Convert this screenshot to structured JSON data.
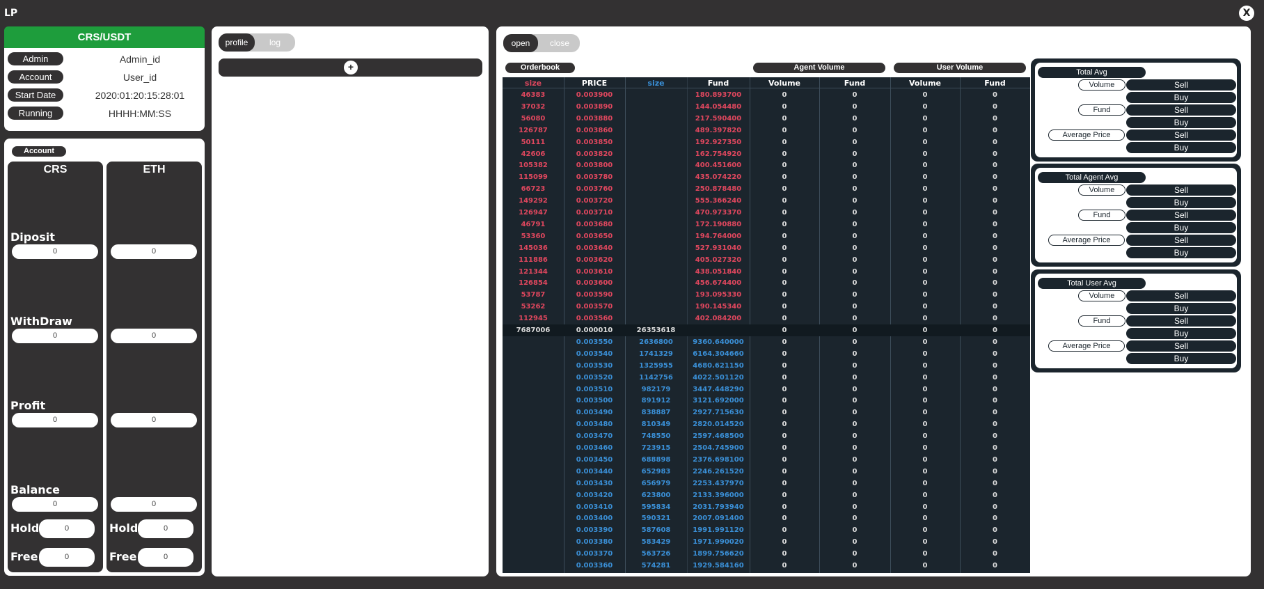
{
  "app": {
    "title": "LP",
    "close_label": "X"
  },
  "info": {
    "pair": "CRS/USDT",
    "rows": [
      {
        "label": "Admin",
        "value": "Admin_id"
      },
      {
        "label": "Account",
        "value": "User_id"
      },
      {
        "label": "Start Date",
        "value": "2020:01:20:15:28:01"
      },
      {
        "label": "Running",
        "value": "HHHH:MM:SS"
      }
    ]
  },
  "account": {
    "title": "Account",
    "columns": [
      "CRS",
      "ETH"
    ],
    "rows": [
      "Diposit",
      "WithDraw",
      "Profit",
      "Balance"
    ],
    "values": {
      "CRS": [
        "0",
        "0",
        "0",
        "0"
      ],
      "ETH": [
        "0",
        "0",
        "0",
        "0"
      ]
    },
    "hold_label": "Hold",
    "free_label": "Free",
    "hold": {
      "CRS": "0",
      "ETH": "0"
    },
    "free": {
      "CRS": "0",
      "ETH": "0"
    }
  },
  "middle": {
    "tab_profile": "profile",
    "tab_log": "log",
    "add_label": "+"
  },
  "right": {
    "tab_open": "open",
    "tab_close": "close"
  },
  "orderbook": {
    "title": "Orderbook",
    "agent_title": "Agent Volume",
    "user_title": "User Volume",
    "headers": [
      "size",
      "PRICE",
      "size",
      "Fund",
      "Volume",
      "Fund",
      "Volume",
      "Fund"
    ],
    "asks": [
      [
        "46383",
        "0.003900",
        "180.893700"
      ],
      [
        "37032",
        "0.003890",
        "144.054480"
      ],
      [
        "56080",
        "0.003880",
        "217.590400"
      ],
      [
        "126787",
        "0.003860",
        "489.397820"
      ],
      [
        "50111",
        "0.003850",
        "192.927350"
      ],
      [
        "42606",
        "0.003820",
        "162.754920"
      ],
      [
        "105382",
        "0.003800",
        "400.451600"
      ],
      [
        "115099",
        "0.003780",
        "435.074220"
      ],
      [
        "66723",
        "0.003760",
        "250.878480"
      ],
      [
        "149292",
        "0.003720",
        "555.366240"
      ],
      [
        "126947",
        "0.003710",
        "470.973370"
      ],
      [
        "46791",
        "0.003680",
        "172.190880"
      ],
      [
        "53360",
        "0.003650",
        "194.764000"
      ],
      [
        "145036",
        "0.003640",
        "527.931040"
      ],
      [
        "111886",
        "0.003620",
        "405.027320"
      ],
      [
        "121344",
        "0.003610",
        "438.051840"
      ],
      [
        "126854",
        "0.003600",
        "456.674400"
      ],
      [
        "53787",
        "0.003590",
        "193.095330"
      ],
      [
        "53262",
        "0.003570",
        "190.145340"
      ],
      [
        "112945",
        "0.003560",
        "402.084200"
      ]
    ],
    "mid": [
      "7687006",
      "0.000010",
      "26353618"
    ],
    "bids": [
      [
        "0.003550",
        "2636800",
        "9360.640000"
      ],
      [
        "0.003540",
        "1741329",
        "6164.304660"
      ],
      [
        "0.003530",
        "1325955",
        "4680.621150"
      ],
      [
        "0.003520",
        "1142756",
        "4022.501120"
      ],
      [
        "0.003510",
        "982179",
        "3447.448290"
      ],
      [
        "0.003500",
        "891912",
        "3121.692000"
      ],
      [
        "0.003490",
        "838887",
        "2927.715630"
      ],
      [
        "0.003480",
        "810349",
        "2820.014520"
      ],
      [
        "0.003470",
        "748550",
        "2597.468500"
      ],
      [
        "0.003460",
        "723915",
        "2504.745900"
      ],
      [
        "0.003450",
        "688898",
        "2376.698100"
      ],
      [
        "0.003440",
        "652983",
        "2246.261520"
      ],
      [
        "0.003430",
        "656979",
        "2253.437970"
      ],
      [
        "0.003420",
        "623800",
        "2133.396000"
      ],
      [
        "0.003410",
        "595834",
        "2031.793940"
      ],
      [
        "0.003400",
        "590321",
        "2007.091400"
      ],
      [
        "0.003390",
        "587608",
        "1991.991120"
      ],
      [
        "0.003380",
        "583429",
        "1971.990020"
      ],
      [
        "0.003370",
        "563726",
        "1899.756620"
      ],
      [
        "0.003360",
        "574281",
        "1929.584160"
      ]
    ],
    "zero": "0"
  },
  "averages": [
    {
      "title": "Total Avg"
    },
    {
      "title": "Total Agent Avg"
    },
    {
      "title": "Total User Avg"
    }
  ],
  "avg_labels": {
    "volume": "Volume",
    "fund": "Fund",
    "avg_price": "Average Price",
    "sell": "Sell",
    "buy": "Buy"
  }
}
